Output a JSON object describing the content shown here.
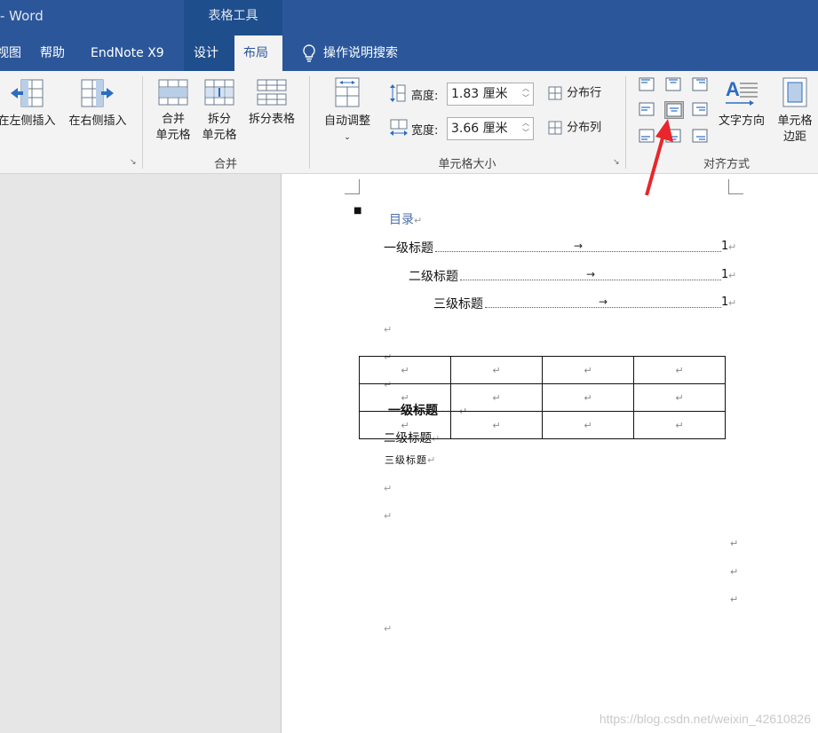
{
  "titlebar": {
    "app_title": "- Word",
    "context_tab": "表格工具"
  },
  "tabs": [
    {
      "label": "视图",
      "shown": "视图"
    },
    {
      "label": "帮助"
    },
    {
      "label": "EndNote X9"
    },
    {
      "label": "设计"
    },
    {
      "label": "布局"
    },
    {
      "label": "操作说明搜索"
    }
  ],
  "ribbon": {
    "rows_cols": {
      "insert_left": "在左侧插入",
      "insert_right": "在右侧插入"
    },
    "merge": {
      "merge_cells_1": "合并",
      "merge_cells_2": "单元格",
      "split_cells_1": "拆分",
      "split_cells_2": "单元格",
      "split_table": "拆分表格",
      "group_label": "合并"
    },
    "cell_size": {
      "autofit": "自动调整",
      "height_label": "高度:",
      "height_value": "1.83 厘米",
      "width_label": "宽度:",
      "width_value": "3.66 厘米",
      "distribute_rows": "分布行",
      "distribute_cols": "分布列",
      "group_label": "单元格大小"
    },
    "alignment": {
      "text_direction": "文字方向",
      "cell_margins_1": "单元格",
      "cell_margins_2": "边距",
      "group_label": "对齐方式"
    }
  },
  "document": {
    "toc_title": "目录",
    "toc": [
      {
        "text": "一级标题",
        "page": "1"
      },
      {
        "text": "二级标题",
        "page": "1"
      },
      {
        "text": "三级标题",
        "page": "1"
      }
    ],
    "heading1": "一级标题",
    "heading1_dots": "· · ·",
    "heading2": "二级标题",
    "heading3": "三级标题",
    "para_mark": "↵",
    "tab_arrow": "→"
  },
  "watermark": "https://blog.csdn.net/weixin_42610826",
  "colors": {
    "accent": "#2b579a",
    "context": "#1f4e8c",
    "annotation_arrow": "#e8262b"
  }
}
